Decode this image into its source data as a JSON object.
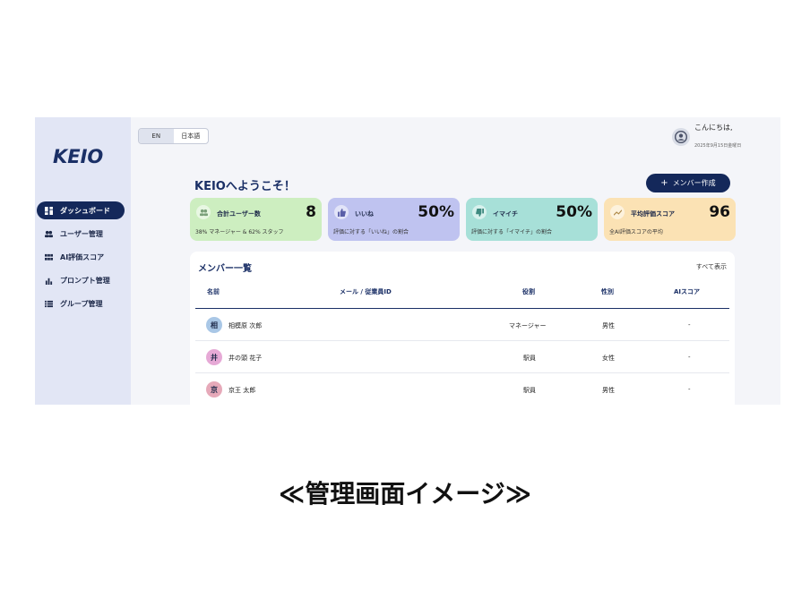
{
  "app": {
    "logo": "KEIO"
  },
  "sidebar": {
    "items": [
      {
        "label": "ダッシュボード",
        "icon": "dashboard-icon",
        "active": true
      },
      {
        "label": "ユーザー管理",
        "icon": "users-icon",
        "active": false
      },
      {
        "label": "AI評価スコア",
        "icon": "grid-icon",
        "active": false
      },
      {
        "label": "プロンプト管理",
        "icon": "bar-chart-icon",
        "active": false
      },
      {
        "label": "グループ管理",
        "icon": "list-icon",
        "active": false
      }
    ]
  },
  "header": {
    "lang_en": "EN",
    "lang_ja": "日本語",
    "greeting": "こんにちは,",
    "date": "2025年9月15日金曜日"
  },
  "main": {
    "welcome": "KEIOへようこそ！",
    "create_button": "メンバー作成",
    "cards": [
      {
        "label": "合計ユーザー数",
        "value": "8",
        "sub": "38% マネージャー & 62% スタッフ",
        "color": "#cdeec0",
        "icon": "users-icon"
      },
      {
        "label": "いいね",
        "value": "50%",
        "sub": "評価に対する「いいね」の割合",
        "color": "#bfc3f0",
        "icon": "thumbs-up-icon"
      },
      {
        "label": "イマイチ",
        "value": "50%",
        "sub": "評価に対する「イマイチ」の割合",
        "color": "#a7e0d8",
        "icon": "thumbs-down-icon"
      },
      {
        "label": "平均評価スコア",
        "value": "96",
        "sub": "全AI評価スコアの平均",
        "color": "#fbe2b4",
        "icon": "trend-icon"
      }
    ],
    "members": {
      "title": "メンバー一覧",
      "show_all": "すべて表示",
      "columns": [
        "名前",
        "メール / 従業員ID",
        "役割",
        "性別",
        "AIスコア"
      ],
      "rows": [
        {
          "initial": "相",
          "name": "相模原 次郎",
          "email": "",
          "role": "マネージャー",
          "gender": "男性",
          "score": "-",
          "avatar_color": "#a9c7e6"
        },
        {
          "initial": "井",
          "name": "井の頭 花子",
          "email": "",
          "role": "駅員",
          "gender": "女性",
          "score": "-",
          "avatar_color": "#e6a9d6"
        },
        {
          "initial": "京",
          "name": "京王 太郎",
          "email": "",
          "role": "駅員",
          "gender": "男性",
          "score": "-",
          "avatar_color": "#e6a9b9"
        }
      ]
    }
  },
  "caption": "≪管理画面イメージ≫"
}
